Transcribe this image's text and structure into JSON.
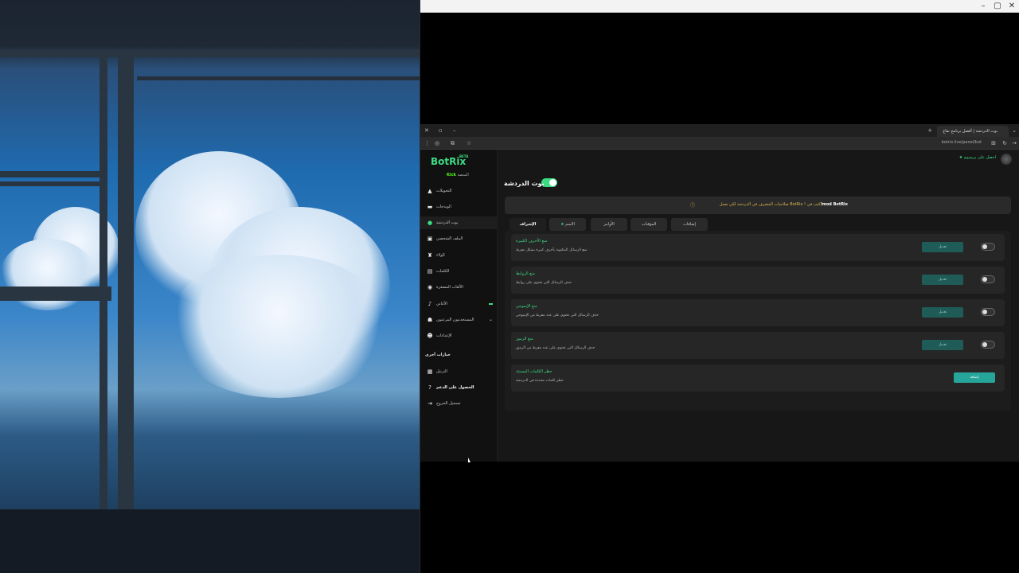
{
  "browser": {
    "tab_title": "بوت الدردشة | أفضل برنامج تفاع",
    "url": "botrix.live/panel/bot"
  },
  "sidebar": {
    "logo": "BotRix",
    "beta": "BETA",
    "platform_label": "المنصة",
    "platform_value": "Kick",
    "items": [
      {
        "label": "التحويلات",
        "icon": "warning-icon"
      },
      {
        "label": "الويدجات",
        "icon": "widget-icon"
      },
      {
        "label": "بوت الدردشة",
        "icon": "chat-bot-icon"
      },
      {
        "label": "الملف الشخصي",
        "icon": "profile-card-icon"
      },
      {
        "label": "الولاء",
        "icon": "trophy-icon"
      },
      {
        "label": "الكلمات",
        "icon": "document-icon"
      },
      {
        "label": "الألعاب المصغرة",
        "icon": "gamepad-icon"
      },
      {
        "label": "الأغاني",
        "icon": "music-icon"
      },
      {
        "label": "المستخدمون المرعيون",
        "icon": "users-icon"
      },
      {
        "label": "الإعدادات",
        "icon": "user-group-icon"
      }
    ],
    "section_title": "خيارات أخرى",
    "extra_items": [
      {
        "label": "الترتيل",
        "icon": "ranking-icon"
      },
      {
        "label": "الحصول على الدعم",
        "icon": "help-icon"
      },
      {
        "label": "تسجيل الخروج",
        "icon": "logout-icon"
      }
    ]
  },
  "header": {
    "premium_label": "احصل على بريميوم"
  },
  "page": {
    "title": "بوت الدردشة",
    "notice_text": "صلاحيات المشرف في الدردشة لكي يعمل BotRix ! اكتب في",
    "notice_command": "/mod BotRix"
  },
  "tabs": [
    "الإشراف",
    "الاسم",
    "الأوامر",
    "المؤقتات",
    "إضافات"
  ],
  "cards": [
    {
      "title": "منع الأحرف الكبيرة",
      "desc": "منع الرسائل المكتوبة بأحرف كبيرة بشكل مفرط",
      "button": "تعديل"
    },
    {
      "title": "منع الروابط",
      "desc": "حذف الرسائل التي تحتوي على روابط",
      "button": "تعديل"
    },
    {
      "title": "منع الإيموجي",
      "desc": "حذف الرسائل التي تحتوي على عدد مفرط من الإيموجي",
      "button": "تعديل"
    },
    {
      "title": "منع الرموز",
      "desc": "حذف الرسائل التي تحتوي على عدد مفرط من الرموز",
      "button": "تعديل"
    },
    {
      "title": "حظر الكلمات المسيئة",
      "desc": "حظر كلمات محددة في الدردشة",
      "button": "إضافة"
    }
  ],
  "colors": {
    "accent": "#3ddc84",
    "button": "#26a69a",
    "notice": "#e0b84a"
  }
}
